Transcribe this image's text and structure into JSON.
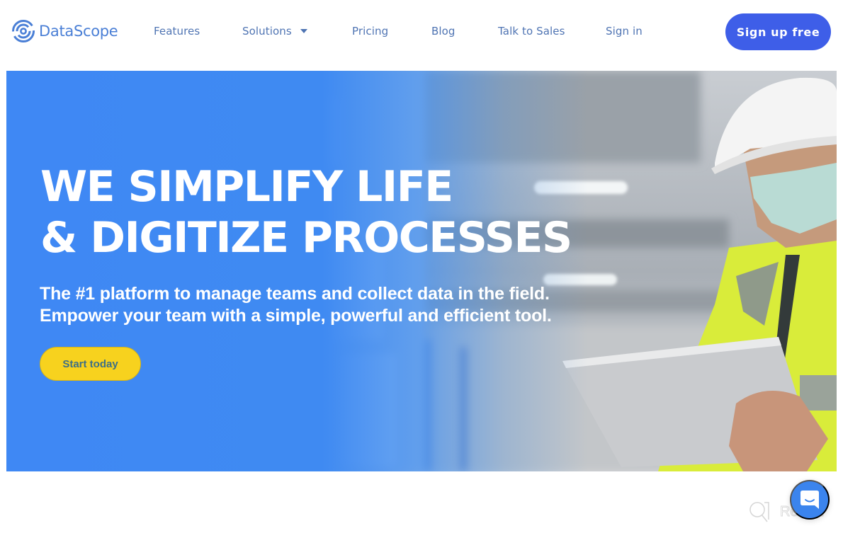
{
  "brand": {
    "name": "DataScope",
    "accent_color": "#3e5ee8",
    "logo_color": "#4a7fd6",
    "hero_blue": "#3f88f4",
    "cta_yellow": "#f7d21e"
  },
  "nav": {
    "items": [
      {
        "label": "Features"
      },
      {
        "label": "Solutions",
        "has_dropdown": true
      },
      {
        "label": "Pricing"
      },
      {
        "label": "Blog"
      },
      {
        "label": "Talk to Sales"
      },
      {
        "label": "Sign in"
      }
    ],
    "signup_label": "Sign up free"
  },
  "hero": {
    "title_line1": "WE SIMPLIFY LIFE",
    "title_line2": "& DIGITIZE PROCESSES",
    "subtitle_line1": "The #1 platform to manage teams and collect data in the field.",
    "subtitle_line2": "Empower your team with a simple, powerful and efficient tool.",
    "cta_label": "Start today",
    "image_description": "Warehouse worker in white hard hat, face mask and yellow hi-vis jacket holding a tablet"
  },
  "widgets": {
    "chat_icon": "chat-bubble-smile-icon",
    "watermark_text": "Revain"
  }
}
